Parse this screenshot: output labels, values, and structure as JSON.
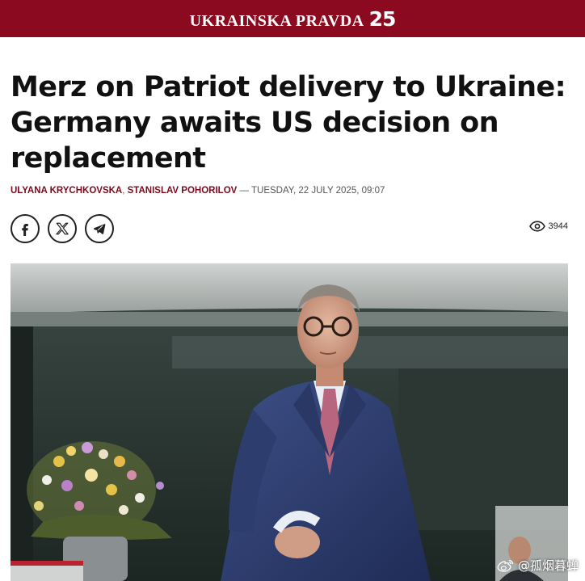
{
  "masthead": {
    "name": "UKRAINSKA PRAVDA",
    "anniversary": "25",
    "background_color": "#8b0a1f"
  },
  "article": {
    "title": "Merz on Patriot delivery to Ukraine: Germany awaits US decision on replacement",
    "authors": [
      "ULYANA KRYCHKOVSKA",
      "STANISLAV POHORILOV"
    ],
    "dash": "—",
    "date": "TUESDAY, 22 JULY 2025, 09:07",
    "views": "3944"
  },
  "share": {
    "buttons": [
      "facebook-icon",
      "x-icon",
      "telegram-icon"
    ]
  },
  "watermark": {
    "icon": "weibo-icon",
    "handle": "@孤烟暮蝉"
  }
}
